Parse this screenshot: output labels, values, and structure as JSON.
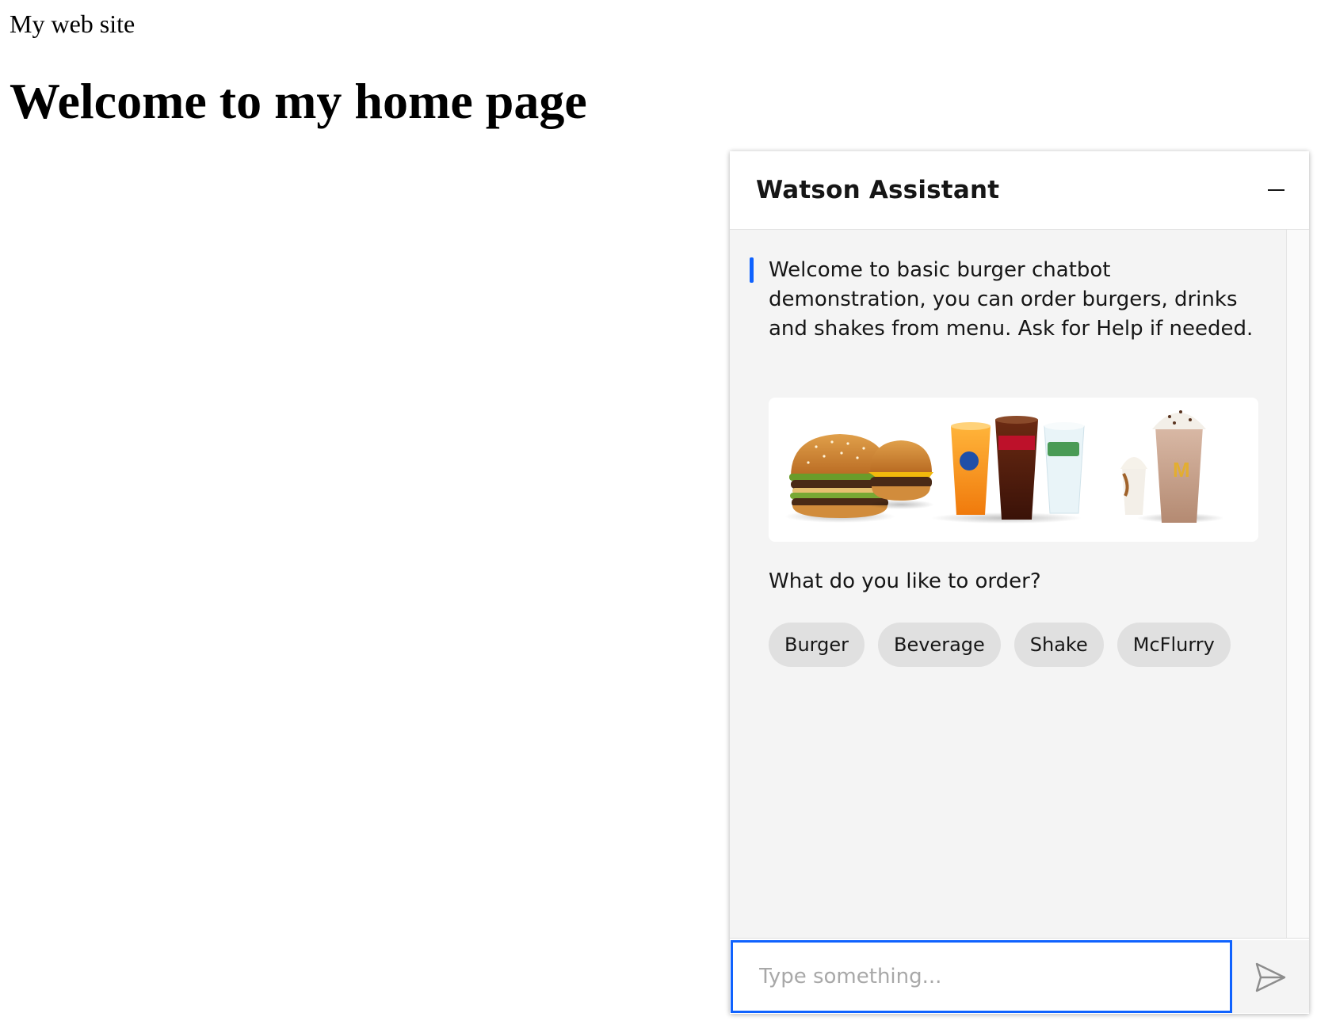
{
  "page": {
    "site_name": "My web site",
    "heading": "Welcome to my home page"
  },
  "chat": {
    "title": "Watson Assistant",
    "minimize_icon": "minus-icon",
    "welcome_message": "Welcome to basic burger chatbot demonstration, you can order burgers, drinks and shakes from menu. Ask for Help if needed.",
    "menu_image_items": [
      "burgers",
      "beverages",
      "shakes"
    ],
    "question": "What do you like to order?",
    "options": [
      {
        "label": "Burger"
      },
      {
        "label": "Beverage"
      },
      {
        "label": "Shake"
      },
      {
        "label": "McFlurry"
      }
    ],
    "input_placeholder": "Type something...",
    "input_value": "",
    "send_icon": "send-icon",
    "colors": {
      "accent": "#0f62fe",
      "panel_bg": "#f4f4f4",
      "chip_bg": "#e0e0e0",
      "text": "#161616"
    }
  }
}
